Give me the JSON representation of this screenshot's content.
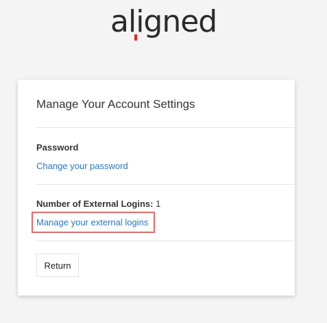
{
  "brand": {
    "logo_text": "aligned",
    "accent_color": "#e32a1f"
  },
  "card": {
    "title": "Manage Your Account Settings",
    "password": {
      "label": "Password",
      "link": "Change your password"
    },
    "external_logins": {
      "label": "Number of External Logins:",
      "count": "1",
      "link": "Manage your external logins"
    },
    "return_button": "Return"
  },
  "colors": {
    "link": "#2a77bd",
    "highlight": "#dc6b6b"
  }
}
